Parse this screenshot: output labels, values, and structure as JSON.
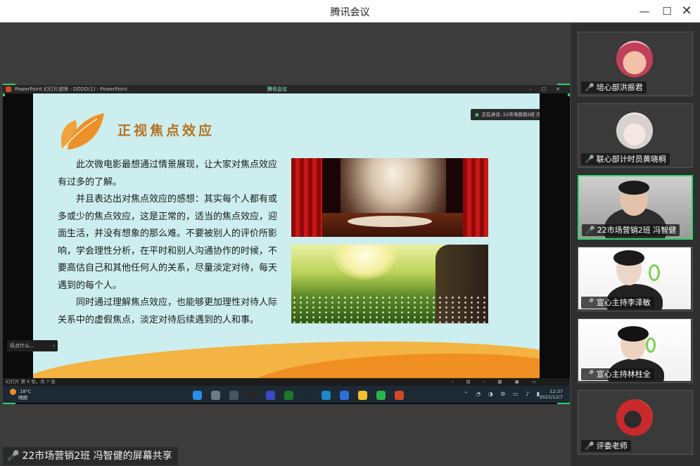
{
  "window": {
    "title": "腾讯会议"
  },
  "controls": {
    "minimize": "—",
    "maximize": "☐",
    "close": "✕"
  },
  "ppt": {
    "titlebar": "PowerPoint 幻灯片放映 - DDDD(1) - PowerPoint",
    "meeting_tag": "腾讯会议",
    "status": "幻灯片 第 6 张，共 7 张"
  },
  "slide": {
    "title": "正视焦点效应",
    "paragraphs": [
      "此次微电影最想通过情景展现，让大家对焦点效应有过多的了解。",
      "并且表达出对焦点效应的感想：其实每个人都有或多或少的焦点效应，这是正常的，适当的焦点效应，迎面生活，并没有想象的那么难。不要被别人的评价所影响，学会理性分析，在平时和别人沟通协作的时候，不要高估自己和其他任何人的关系，尽量淡定对待，每天遇到的每个人。",
      "同时通过理解焦点效应，也能够更加理性对待人际关系中的虚假焦点，淡定对待后续遇到的人和事。"
    ]
  },
  "speaking": "正在讲话: 22市场营销2班 冯智...",
  "side_chip": "讯点什么...",
  "taskbar": {
    "weather_temp": "18°C",
    "weather_desc": "晴朗",
    "time": "12:37",
    "date": "2022/12/7"
  },
  "share_caption": "22市场营销2班 冯智健的屏幕共享",
  "participants": [
    {
      "name": "培心部洪振君",
      "mic": "off"
    },
    {
      "name": "联心部计时员黄晓桐",
      "mic": "on"
    },
    {
      "name": "22市场营销2班 冯智健",
      "mic": "on",
      "active": true
    },
    {
      "name": "宣心主持李泽敏",
      "mic": "on"
    },
    {
      "name": "宣心主持林柱全",
      "mic": "on"
    },
    {
      "name": "评委老师",
      "mic": "off"
    }
  ],
  "colors": {
    "active_border": "#2fd46b",
    "slide_bg": "#cdeeee",
    "title_orange": "#b5711f"
  }
}
